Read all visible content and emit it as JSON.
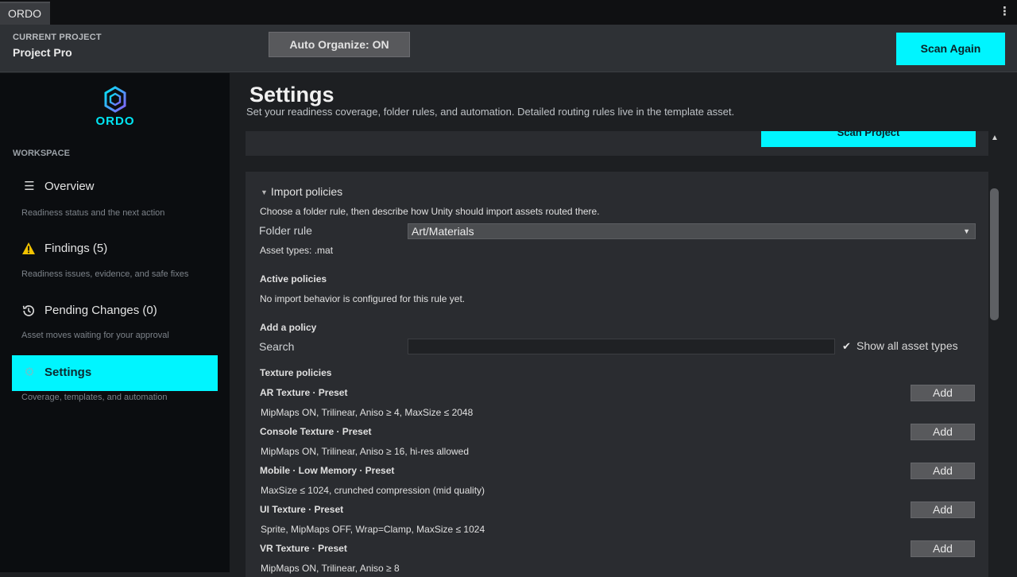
{
  "tab": {
    "label": "ORDO"
  },
  "window": {
    "menu_icon": "kebab-menu-icon"
  },
  "header": {
    "project_caption": "CURRENT PROJECT",
    "project_name": "Project Pro",
    "auto_organize_label": "Auto Organize: ON",
    "scan_again_label": "Scan Again"
  },
  "sidebar": {
    "logo_text": "ORDO",
    "section_caption": "WORKSPACE",
    "items": [
      {
        "label": "Overview",
        "desc": "Readiness status and the next action",
        "icon": "list-icon"
      },
      {
        "label": "Findings (5)",
        "desc": "Readiness issues, evidence, and safe fixes",
        "icon": "warning-icon"
      },
      {
        "label": "Pending Changes (0)",
        "desc": "Asset moves waiting for your approval",
        "icon": "history-icon"
      },
      {
        "label": "Settings",
        "desc": "Coverage, templates, and automation",
        "icon": "gear-icon"
      }
    ],
    "active_index": 3
  },
  "main": {
    "title": "Settings",
    "subtitle": "Set your readiness coverage, folder rules, and automation. Detailed routing rules live in the template asset.",
    "prev_button_label": "Scan Project",
    "import": {
      "heading": "Import policies",
      "intro": "Choose a folder rule, then describe how Unity should import assets routed there.",
      "folder_rule_label": "Folder rule",
      "folder_rule_value": "Art/Materials",
      "asset_types": "Asset types: .mat",
      "active_heading": "Active policies",
      "active_empty": "No import behavior is configured for this rule yet.",
      "add_heading": "Add a policy",
      "search_label": "Search",
      "search_value": "",
      "show_all_label": "Show all asset types",
      "show_all_checked": true,
      "texture_heading": "Texture policies",
      "add_label": "Add",
      "policies": [
        {
          "name": "AR Texture · Preset",
          "desc": "MipMaps ON, Trilinear, Aniso ≥ 4, MaxSize ≤ 2048"
        },
        {
          "name": "Console Texture · Preset",
          "desc": "MipMaps ON, Trilinear, Aniso ≥ 16, hi-res allowed"
        },
        {
          "name": "Mobile · Low Memory · Preset",
          "desc": "MaxSize ≤ 1024, crunched compression (mid quality)"
        },
        {
          "name": "UI Texture · Preset",
          "desc": "Sprite, MipMaps OFF, Wrap=Clamp, MaxSize ≤ 1024"
        },
        {
          "name": "VR Texture · Preset",
          "desc": "MipMaps ON, Trilinear, Aniso ≥ 8"
        }
      ]
    }
  },
  "colors": {
    "accent": "#00f5ff",
    "sidebar_bg": "#0b0d10",
    "header_bg": "#2e3135",
    "card_bg": "#2a2c30",
    "warning": "#f2c200"
  }
}
